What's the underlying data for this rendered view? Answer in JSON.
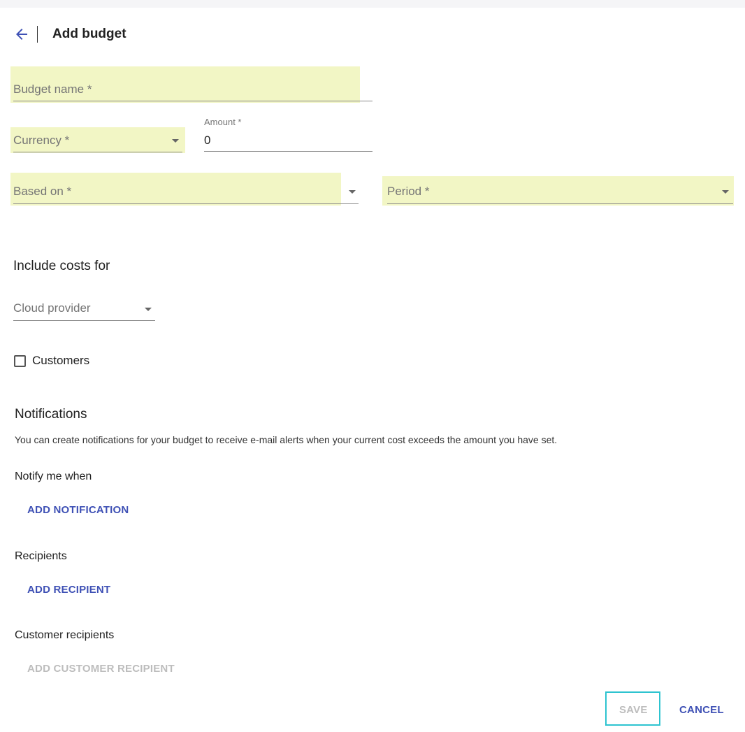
{
  "header": {
    "title": "Add budget",
    "back_icon": "arrow-left-icon"
  },
  "form": {
    "budget_name": {
      "label": "Budget name *",
      "value": ""
    },
    "currency": {
      "label": "Currency *",
      "value": ""
    },
    "amount": {
      "label": "Amount *",
      "value": "0"
    },
    "based_on": {
      "label": "Based on *",
      "value": ""
    },
    "period": {
      "label": "Period *",
      "value": ""
    }
  },
  "include_costs": {
    "heading": "Include costs for",
    "cloud_provider": {
      "placeholder": "Cloud provider"
    },
    "customers": {
      "label": "Customers",
      "checked": false
    }
  },
  "notifications": {
    "heading": "Notifications",
    "description": "You can create notifications for your budget to receive e-mail alerts when your current cost exceeds the amount you have set.",
    "notify_label": "Notify me when",
    "add_notification": "ADD NOTIFICATION",
    "recipients_label": "Recipients",
    "add_recipient": "ADD RECIPIENT",
    "customer_recipients_label": "Customer recipients",
    "add_customer_recipient": "ADD CUSTOMER RECIPIENT"
  },
  "actions": {
    "save": "SAVE",
    "cancel": "CANCEL"
  },
  "colors": {
    "accent": "#3f51b5",
    "highlight": "#f2f6c5",
    "focus_outline": "#2ec4d0",
    "disabled": "#bdbdbd"
  }
}
